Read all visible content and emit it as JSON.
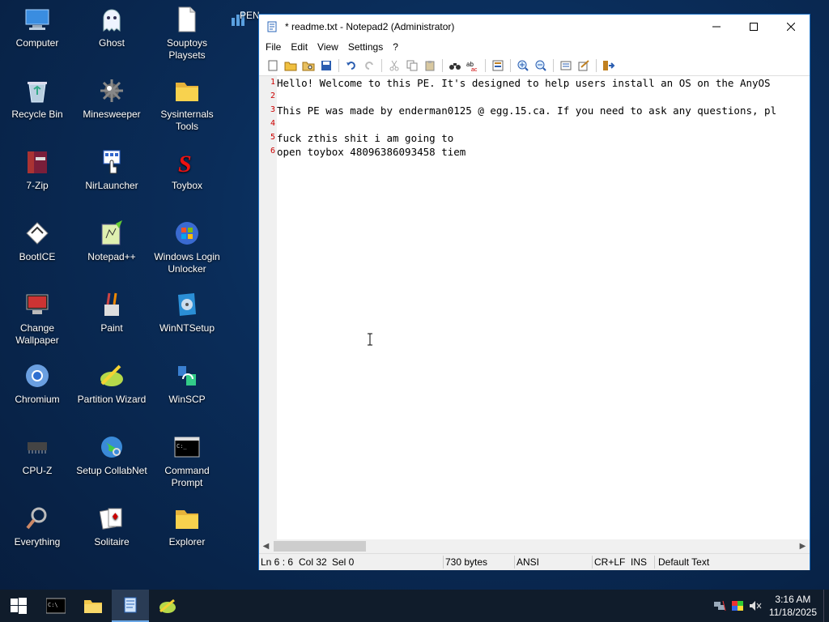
{
  "desktop": {
    "icons": [
      {
        "label": "Computer",
        "icon": "computer-icon"
      },
      {
        "label": "Ghost",
        "icon": "ghost-icon"
      },
      {
        "label": "Souptoys Playsets",
        "icon": "file-icon"
      },
      {
        "label": "PEN",
        "icon": "network-icon"
      },
      {
        "label": "Recycle Bin",
        "icon": "recycle-bin-icon"
      },
      {
        "label": "Minesweeper",
        "icon": "mine-icon"
      },
      {
        "label": "Sysinternals Tools",
        "icon": "folder-icon"
      },
      {
        "label": "7-Zip",
        "icon": "archive-icon"
      },
      {
        "label": "NirLauncher",
        "icon": "launcher-icon"
      },
      {
        "label": "Toybox",
        "icon": "toybox-icon"
      },
      {
        "label": "BootICE",
        "icon": "bootice-icon"
      },
      {
        "label": "Notepad++",
        "icon": "notepadpp-icon"
      },
      {
        "label": "Windows Login Unlocker",
        "icon": "windows-logo-icon"
      },
      {
        "label": "Change Wallpaper",
        "icon": "wallpaper-icon"
      },
      {
        "label": "Paint",
        "icon": "paint-icon"
      },
      {
        "label": "WinNTSetup",
        "icon": "setup-icon"
      },
      {
        "label": "Chromium",
        "icon": "chromium-icon"
      },
      {
        "label": "Partition Wizard",
        "icon": "partition-icon"
      },
      {
        "label": "WinSCP",
        "icon": "winscp-icon"
      },
      {
        "label": "CPU-Z",
        "icon": "cpu-icon"
      },
      {
        "label": "Setup CollabNet",
        "icon": "globe-icon"
      },
      {
        "label": "Command Prompt",
        "icon": "cmd-icon"
      },
      {
        "label": "Everything",
        "icon": "magnifier-icon"
      },
      {
        "label": "Solitaire",
        "icon": "cards-icon"
      },
      {
        "label": "Explorer",
        "icon": "folder-icon"
      }
    ]
  },
  "window": {
    "title": "* readme.txt - Notepad2 (Administrator)",
    "menu": [
      "File",
      "Edit",
      "View",
      "Settings",
      "?"
    ],
    "lines": [
      {
        "num": "1",
        "text": "Hello! Welcome to this PE. It's designed to help users install an OS on the AnyOS"
      },
      {
        "num": "2",
        "text": ""
      },
      {
        "num": "3",
        "text": "This PE was made by enderman0125 @ egg.15.ca. If you need to ask any questions, pl"
      },
      {
        "num": "4",
        "text": ""
      },
      {
        "num": "5",
        "text": "fuck zthis shit i am going to"
      },
      {
        "num": "6",
        "text": "open toybox 48096386093458 tiem"
      }
    ],
    "status": {
      "position": "Ln 6 : 6",
      "col": "Col 32",
      "sel": "Sel 0",
      "size": "730 bytes",
      "encoding": "ANSI",
      "eol": "CR+LF",
      "mode": "INS",
      "scheme": "Default Text"
    }
  },
  "taskbar": {
    "time": "3:16 AM",
    "date": "11/18/2025"
  }
}
